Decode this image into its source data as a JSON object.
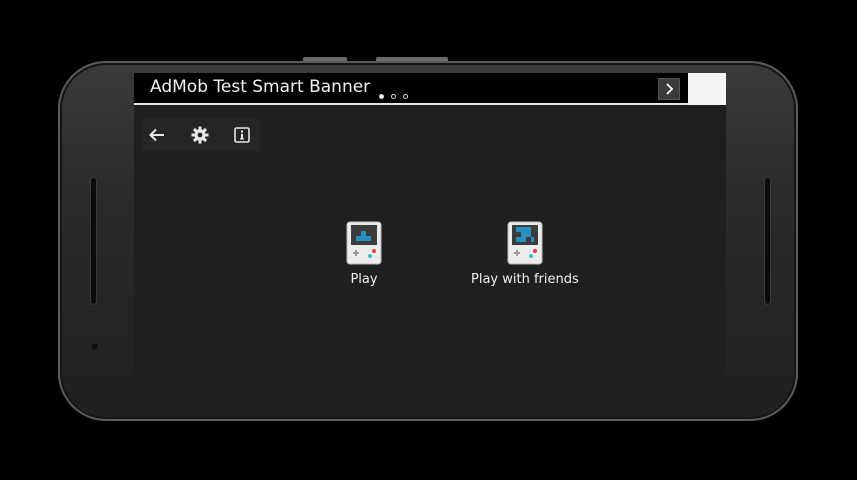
{
  "ad_banner": {
    "title": "AdMob Test Smart Banner",
    "pager_dots": 3,
    "active_dot": 0,
    "next_icon": "chevron-right-icon"
  },
  "toolbar": {
    "back_icon": "arrow-left-icon",
    "settings_icon": "gear-icon",
    "info_icon": "info-icon"
  },
  "menu": {
    "play_label": "Play",
    "play_friends_label": "Play with friends"
  },
  "colors": {
    "screen_bg": "#1f1f1f",
    "tile_accent": "#2a8fbf",
    "button_red": "#e04040",
    "button_cyan": "#3fb6e0"
  }
}
